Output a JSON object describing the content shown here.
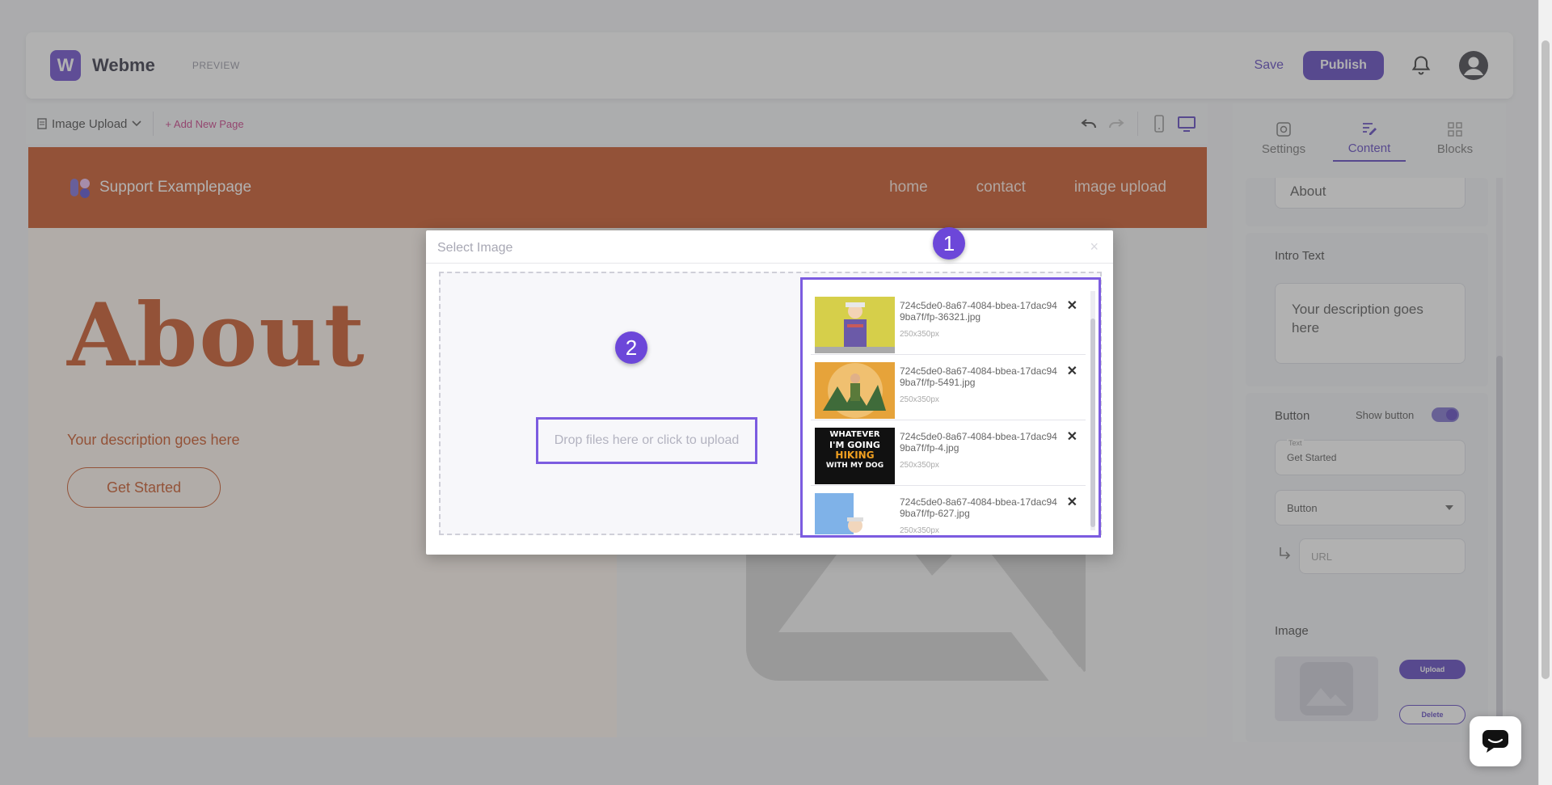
{
  "header": {
    "logo_letter": "W",
    "brand": "Webme",
    "preview_label": "PREVIEW",
    "save_label": "Save",
    "publish_label": "Publish"
  },
  "toolbar": {
    "page_select": "Image Upload",
    "add_page": "+ Add New Page"
  },
  "site": {
    "name": "Support Examplepage",
    "nav": [
      "home",
      "contact",
      "image upload"
    ],
    "hero_title": "About",
    "hero_desc": "Your description goes here",
    "hero_button": "Get Started"
  },
  "panel": {
    "tabs": [
      {
        "label": "Settings",
        "icon": "gear-icon"
      },
      {
        "label": "Content",
        "icon": "edit-icon"
      },
      {
        "label": "Blocks",
        "icon": "grid-icon"
      }
    ],
    "top_field": "About",
    "intro_label": "Intro Text",
    "intro_value": "Your description goes here",
    "button_label": "Button",
    "show_button_label": "Show button",
    "text_field_label": "Text",
    "text_field_value": "Get Started",
    "button_type": "Button",
    "url_placeholder": "URL",
    "image_label": "Image",
    "upload_label": "Upload",
    "delete_label": "Delete"
  },
  "modal": {
    "title": "Select Image",
    "close": "×",
    "drop_text": "Drop files here or click to upload",
    "badge_1": "1",
    "badge_2": "2",
    "files": [
      {
        "name": "724c5de0-8a67-4084-bbea-17dac949ba7f/fp-36321.jpg",
        "size": "250x350px"
      },
      {
        "name": "724c5de0-8a67-4084-bbea-17dac949ba7f/fp-5491.jpg",
        "size": "250x350px"
      },
      {
        "name": "724c5de0-8a67-4084-bbea-17dac949ba7f/fp-4.jpg",
        "size": "250x350px"
      },
      {
        "name": "724c5de0-8a67-4084-bbea-17dac949ba7f/fp-627.jpg",
        "size": "250x350px"
      }
    ],
    "thumb3_lines": [
      "WHATEVER",
      "I'M GOING",
      "HIKING",
      "WITH MY DOG"
    ]
  },
  "colors": {
    "accent": "#4b2fb8",
    "site_primary": "#c2410c",
    "highlight": "#7c5ce0"
  }
}
